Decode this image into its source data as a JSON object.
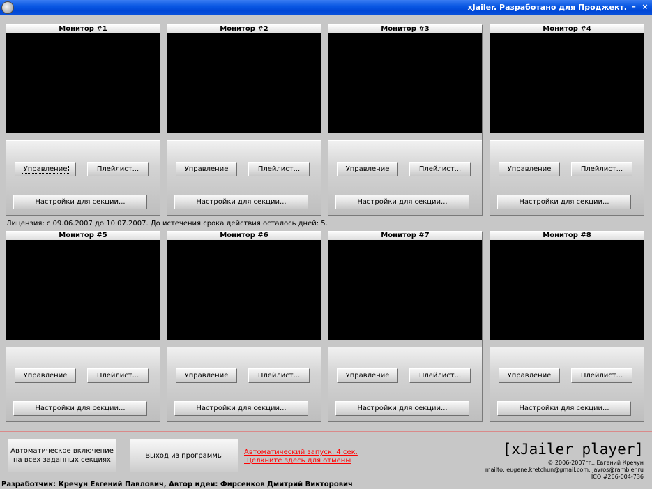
{
  "window": {
    "title": "xJailer. Разработано для Проджект.",
    "minimize_glyph": "–",
    "close_glyph": "×"
  },
  "monitors": [
    {
      "title": "Монитор #1",
      "control_label": "Управление",
      "playlist_label": "Плейлист...",
      "settings_label": "Настройки для секции..."
    },
    {
      "title": "Монитор #2",
      "control_label": "Управление",
      "playlist_label": "Плейлист...",
      "settings_label": "Настройки для секции..."
    },
    {
      "title": "Монитор #3",
      "control_label": "Управление",
      "playlist_label": "Плейлист...",
      "settings_label": "Настройки для секции..."
    },
    {
      "title": "Монитор #4",
      "control_label": "Управление",
      "playlist_label": "Плейлист...",
      "settings_label": "Настройки для секции..."
    },
    {
      "title": "Монитор #5",
      "control_label": "Управление",
      "playlist_label": "Плейлист...",
      "settings_label": "Настройки для секции..."
    },
    {
      "title": "Монитор #6",
      "control_label": "Управление",
      "playlist_label": "Плейлист...",
      "settings_label": "Настройки для секции..."
    },
    {
      "title": "Монитор #7",
      "control_label": "Управление",
      "playlist_label": "Плейлист...",
      "settings_label": "Настройки для секции..."
    },
    {
      "title": "Монитор #8",
      "control_label": "Управление",
      "playlist_label": "Плейлист...",
      "settings_label": "Настройки для секции..."
    }
  ],
  "license_text": "Лицензия: с 09.06.2007 до 10.07.2007. До истечения срока действия осталось дней: 5.",
  "footer": {
    "auto_enable_label": "Автоматическое включение на всех заданных секциях",
    "exit_label": "Выход из программы",
    "autostart_line1": "Автоматический запуск: 4 сек.",
    "autostart_line2": "Щелкните здесь для отмены",
    "brand": "[xJailer player]",
    "copyright": "© 2006-2007гг.,  Евгений Кречун",
    "mailto": "mailto: eugene.kretchun@gmail.com; javros@rambler.ru",
    "icq": "ICQ #266-004-736",
    "developer_line": "Разработчик: Кречун Евгений Павлович, Автор идеи: Фирсенков Дмитрий Викторович"
  },
  "colors": {
    "titlebar": "#0a58e3",
    "window_bg": "#c7c7c7",
    "screen": "#000000",
    "link": "#ff0000"
  }
}
